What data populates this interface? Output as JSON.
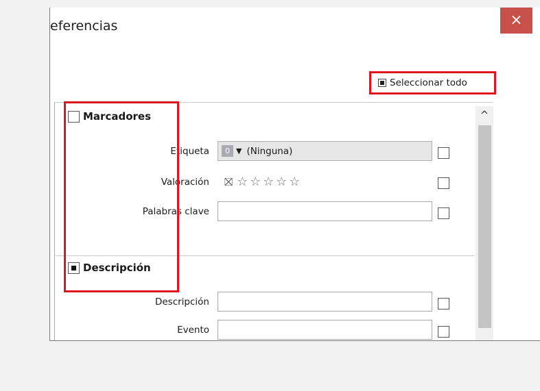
{
  "window": {
    "title": "eferencias",
    "close_label": "×"
  },
  "toolbar": {
    "select_all_label": "Seleccionar todo"
  },
  "sections": {
    "marcadores": {
      "title": "Marcadores",
      "checked": false,
      "fields": {
        "etiqueta": {
          "label": "Etiqueta",
          "chip": "0",
          "arrow": "▼",
          "value": "(Ninguna)"
        },
        "valoracion": {
          "label": "Valoración",
          "reject_icon": "⛝",
          "stars": [
            "☆",
            "☆",
            "☆",
            "☆",
            "☆"
          ],
          "rating": 0
        },
        "palabras_clave": {
          "label": "Palabras clave",
          "value": ""
        }
      }
    },
    "descripcion": {
      "title": "Descripción",
      "checked": true,
      "fields": {
        "descripcion": {
          "label": "Descripción",
          "value": ""
        },
        "evento": {
          "label": "Evento",
          "value": ""
        }
      }
    }
  },
  "scrollbar": {
    "up_arrow": "^"
  },
  "colors": {
    "highlight_red": "#e0141e",
    "close_button": "#c7504a"
  }
}
